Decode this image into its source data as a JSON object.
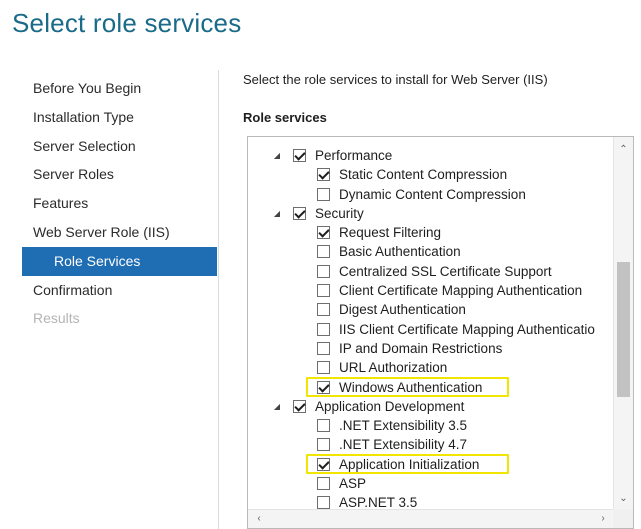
{
  "title": "Select role services",
  "nav": {
    "items": [
      {
        "label": "Before You Begin",
        "state": "normal"
      },
      {
        "label": "Installation Type",
        "state": "normal"
      },
      {
        "label": "Server Selection",
        "state": "normal"
      },
      {
        "label": "Server Roles",
        "state": "normal"
      },
      {
        "label": "Features",
        "state": "normal"
      },
      {
        "label": "Web Server Role (IIS)",
        "state": "normal"
      },
      {
        "label": "Role Services",
        "state": "active"
      },
      {
        "label": "Confirmation",
        "state": "normal"
      },
      {
        "label": "Results",
        "state": "disabled"
      }
    ]
  },
  "main": {
    "intro": "Select the role services to install for Web Server (IIS)",
    "section_label": "Role services",
    "tree": [
      {
        "label": "Performance",
        "level": 1,
        "checked": true,
        "expandable": true
      },
      {
        "label": "Static Content Compression",
        "level": 2,
        "checked": true
      },
      {
        "label": "Dynamic Content Compression",
        "level": 2,
        "checked": false
      },
      {
        "label": "Security",
        "level": 1,
        "checked": true,
        "expandable": true
      },
      {
        "label": "Request Filtering",
        "level": 2,
        "checked": true
      },
      {
        "label": "Basic Authentication",
        "level": 2,
        "checked": false
      },
      {
        "label": "Centralized SSL Certificate Support",
        "level": 2,
        "checked": false
      },
      {
        "label": "Client Certificate Mapping Authentication",
        "level": 2,
        "checked": false
      },
      {
        "label": "Digest Authentication",
        "level": 2,
        "checked": false
      },
      {
        "label": "IIS Client Certificate Mapping Authenticatio",
        "level": 2,
        "checked": false
      },
      {
        "label": "IP and Domain Restrictions",
        "level": 2,
        "checked": false
      },
      {
        "label": "URL Authorization",
        "level": 2,
        "checked": false
      },
      {
        "label": "Windows Authentication",
        "level": 2,
        "checked": true,
        "highlighted": true
      },
      {
        "label": "Application Development",
        "level": 1,
        "checked": true,
        "expandable": true
      },
      {
        "label": ".NET Extensibility 3.5",
        "level": 2,
        "checked": false
      },
      {
        "label": ".NET Extensibility 4.7",
        "level": 2,
        "checked": false
      },
      {
        "label": "Application Initialization",
        "level": 2,
        "checked": true,
        "highlighted": true
      },
      {
        "label": "ASP",
        "level": 2,
        "checked": false
      },
      {
        "label": "ASP.NET 3.5",
        "level": 2,
        "checked": false
      }
    ],
    "scrollbar": {
      "up_icon": "chevron-up-icon",
      "down_icon": "chevron-down-icon",
      "left_icon": "chevron-left-icon",
      "right_icon": "chevron-right-icon"
    }
  },
  "colors": {
    "title": "#1a6a8a",
    "active_nav": "#1f6db3",
    "highlight": "#f2e600"
  }
}
